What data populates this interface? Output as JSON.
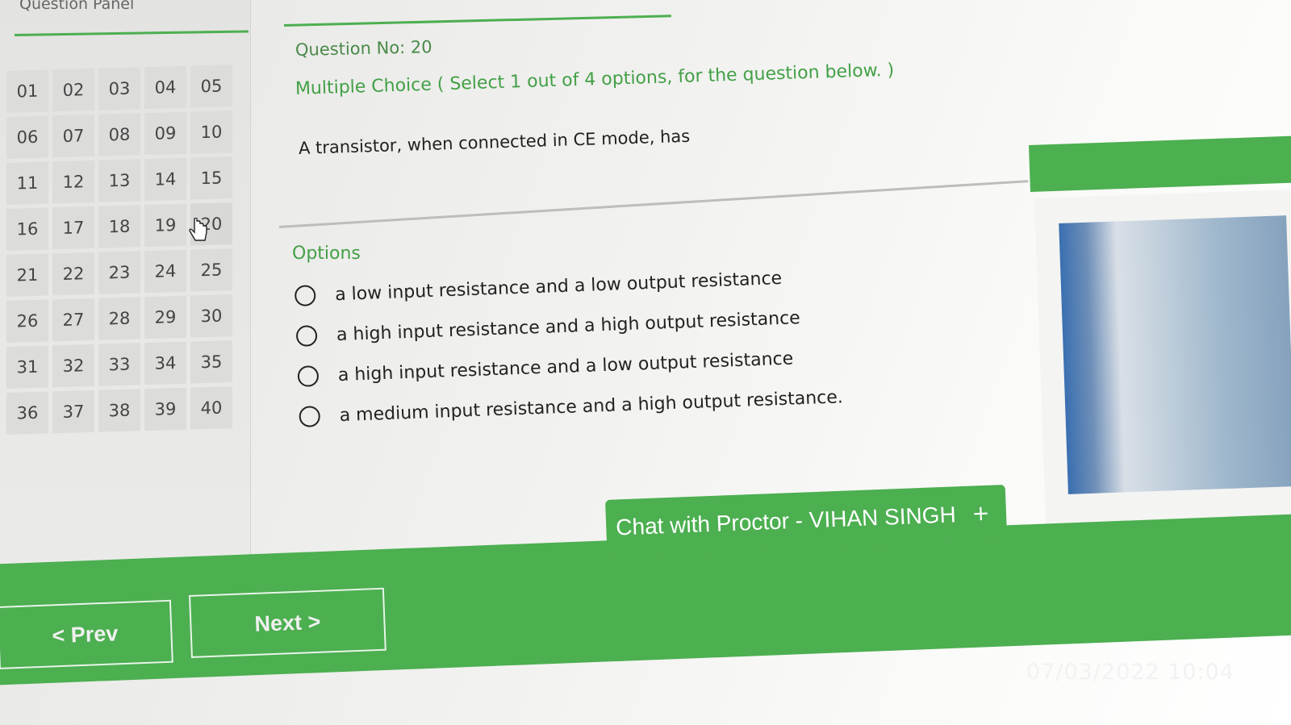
{
  "panel": {
    "title": "Question Panel"
  },
  "question_numbers": [
    "01",
    "02",
    "03",
    "04",
    "05",
    "06",
    "07",
    "08",
    "09",
    "10",
    "11",
    "12",
    "13",
    "14",
    "15",
    "16",
    "17",
    "18",
    "19",
    "20",
    "21",
    "22",
    "23",
    "24",
    "25",
    "26",
    "27",
    "28",
    "29",
    "30",
    "31",
    "32",
    "33",
    "34",
    "35",
    "36",
    "37",
    "38",
    "39",
    "40"
  ],
  "question": {
    "number_label": "Question No: 20",
    "type_label": "Multiple Choice ( Select 1 out of 4 options, for the question below. )",
    "text": "A transistor, when connected in CE mode, has",
    "options_label": "Options",
    "options": [
      "a low input resistance and a low output resistance",
      "a high input resistance and a high output resistance",
      "a high input resistance and a low output resistance",
      "a medium input resistance and a high output resistance."
    ]
  },
  "chat": {
    "label": "Chat with Proctor - VIHAN SINGH",
    "plus": "+"
  },
  "nav": {
    "prev_label": "< Prev",
    "next_label": "Next >"
  },
  "timestamp": "07/03/2022 10:04",
  "colors": {
    "accent": "#4caf50",
    "text": "#222222"
  }
}
